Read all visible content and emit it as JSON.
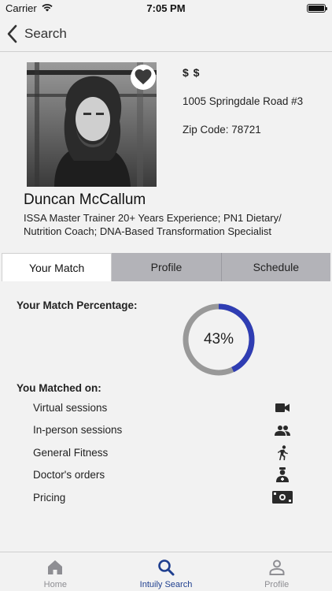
{
  "status_bar": {
    "carrier": "Carrier",
    "time": "7:05 PM"
  },
  "nav": {
    "back_label": "Search"
  },
  "trainer": {
    "name": "Duncan McCallum",
    "bio": "ISSA Master Trainer 20+ Years Experience; PN1 Dietary/ Nutrition Coach; DNA-Based Transformation Specialist",
    "price": "$ $",
    "address_line": "1005 Springdale Road #3",
    "zip": "Zip Code: 78721",
    "favorited": true
  },
  "tabs": [
    {
      "label": "Your Match",
      "active": true
    },
    {
      "label": "Profile",
      "active": false
    },
    {
      "label": "Schedule",
      "active": false
    }
  ],
  "match": {
    "title": "Your Match Percentage:",
    "percent": 43,
    "percent_label": "43%",
    "matched_title": "You Matched on:",
    "criteria": [
      {
        "label": "Virtual sessions",
        "icon": "video-camera-icon"
      },
      {
        "label": "In-person sessions",
        "icon": "people-icon"
      },
      {
        "label": "General Fitness",
        "icon": "running-icon"
      },
      {
        "label": "Doctor's orders",
        "icon": "doctor-icon"
      },
      {
        "label": "Pricing",
        "icon": "money-icon"
      }
    ]
  },
  "tab_bar": [
    {
      "label": "Home",
      "icon": "home-icon",
      "active": false
    },
    {
      "label": "Intuily Search",
      "icon": "search-icon",
      "active": true
    },
    {
      "label": "Profile",
      "icon": "person-icon",
      "active": false
    }
  ],
  "colors": {
    "accent": "#2f3db3",
    "ring_track": "#999999",
    "tab_active_text": "#1f3f8f"
  }
}
